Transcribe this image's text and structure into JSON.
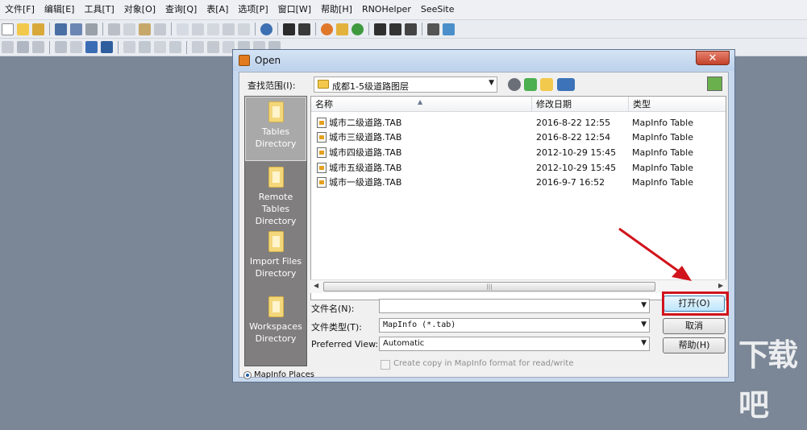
{
  "menubar": {
    "items": [
      "文件[F]",
      "编辑[E]",
      "工具[T]",
      "对象[O]",
      "查询[Q]",
      "表[A]",
      "选项[P]",
      "窗口[W]",
      "帮助[H]",
      "RNOHelper",
      "SeeSite"
    ]
  },
  "dialog": {
    "title": "Open",
    "close_label": "✕",
    "lookin": {
      "label": "查找范围(I):",
      "value": "成都1-5级道路图层"
    },
    "places": [
      {
        "label": "Tables\nDirectory"
      },
      {
        "label": "Remote\nTables\nDirectory"
      },
      {
        "label": "Import Files\nDirectory"
      },
      {
        "label": "Workspaces\nDirectory"
      }
    ],
    "columns": [
      "名称",
      "修改日期",
      "类型"
    ],
    "files": [
      {
        "name": "城市二级道路.TAB",
        "date": "2016-8-22 12:55",
        "type": "MapInfo Table"
      },
      {
        "name": "城市三级道路.TAB",
        "date": "2016-8-22 12:54",
        "type": "MapInfo Table"
      },
      {
        "name": "城市四级道路.TAB",
        "date": "2012-10-29 15:45",
        "type": "MapInfo Table"
      },
      {
        "name": "城市五级道路.TAB",
        "date": "2012-10-29 15:45",
        "type": "MapInfo Table"
      },
      {
        "name": "城市一级道路.TAB",
        "date": "2016-9-7 16:52",
        "type": "MapInfo Table"
      }
    ],
    "filename": {
      "label": "文件名(N):",
      "value": ""
    },
    "filetype": {
      "label": "文件类型(T):",
      "value": "MapInfo (*.tab)"
    },
    "preferred_view": {
      "label": "Preferred View:",
      "value": "Automatic"
    },
    "buttons": {
      "open": "打开(O)",
      "cancel": "取消",
      "help": "帮助(H)"
    },
    "copy_checkbox": "Create copy in MapInfo format for read/write",
    "radio_label": "MapInfo Places"
  },
  "watermark": "下载吧",
  "colors": {
    "highlight": "#d1141b",
    "accent": "#3c7fb1"
  }
}
